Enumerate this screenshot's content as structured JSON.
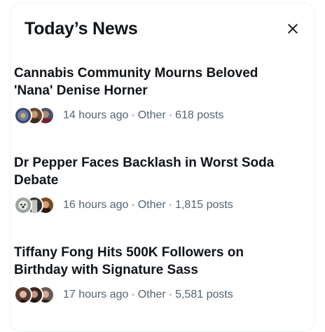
{
  "panel": {
    "title": "Today’s News",
    "close_icon": "close-icon"
  },
  "news": [
    {
      "title": "Cannabis Community Mourns Beloved 'Nana' Denise Horner",
      "time": "14 hours ago",
      "category": "Other",
      "posts": "618 posts",
      "separator": "·"
    },
    {
      "title": "Dr Pepper Faces Backlash in Worst Soda Debate",
      "time": "16 hours ago",
      "category": "Other",
      "posts": "1,815 posts",
      "separator": "·"
    },
    {
      "title": "Tiffany Fong Hits 500K Followers on Birthday with Signature Sass",
      "time": "17 hours ago",
      "category": "Other",
      "posts": "5,581 posts",
      "separator": "·"
    }
  ],
  "colors": {
    "text_primary": "#0f1419",
    "text_secondary": "#536471",
    "border": "#eff3f4"
  }
}
